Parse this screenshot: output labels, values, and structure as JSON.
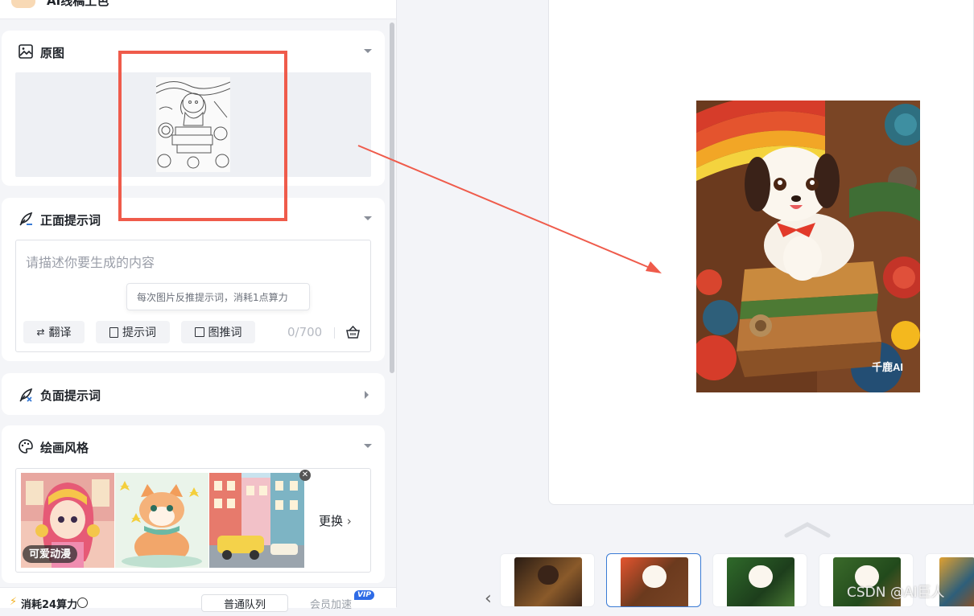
{
  "app": {
    "title": "AI线稿上色"
  },
  "sections": {
    "original": {
      "title": "原图"
    },
    "positive": {
      "title": "正面提示词",
      "placeholder": "请描述你要生成的内容",
      "tooltip": "每次图片反推提示词，消耗1点算力",
      "buttons": {
        "translate": "翻译",
        "prompt": "提示词",
        "img2prompt": "图推词"
      },
      "counter": "0/700"
    },
    "negative": {
      "title": "负面提示词"
    },
    "style": {
      "title": "绘画风格",
      "selected_label": "可爱动漫",
      "change_label": "更换"
    }
  },
  "footer": {
    "cost": "消耗24算力",
    "tabs": [
      "普通队列",
      "会员加速"
    ],
    "vip_badge": "VIP"
  },
  "preview": {
    "watermark": "千鹿AI"
  },
  "credit": "CSDN @AI巨人",
  "colors": {
    "annotation": "#ef5b4b",
    "accent": "#3a7bd5"
  }
}
